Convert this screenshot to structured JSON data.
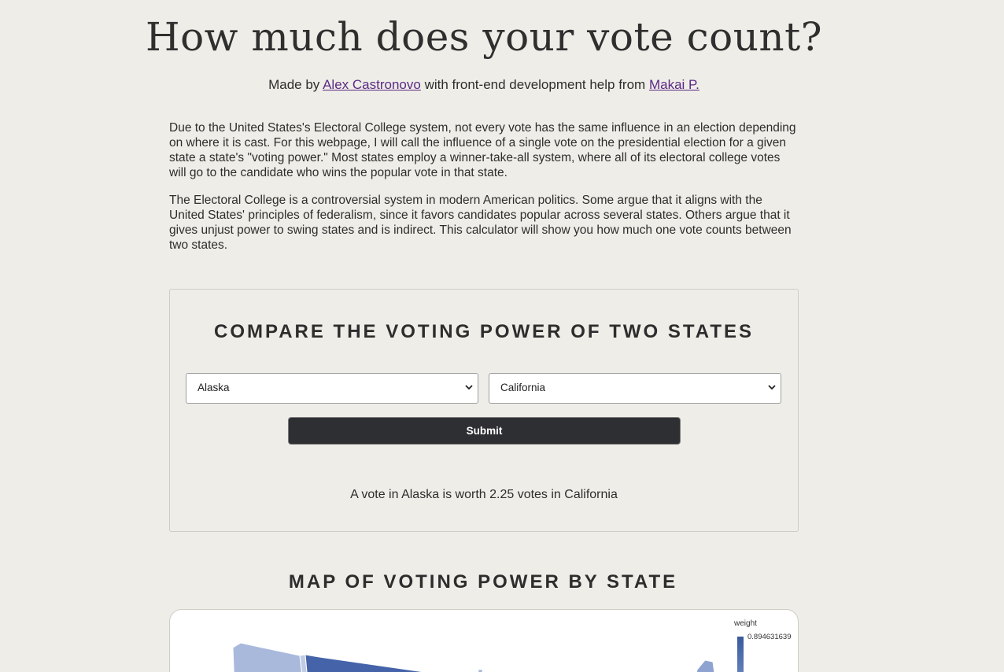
{
  "page": {
    "title": "How much does your vote count?",
    "byline": {
      "prefix": "Made by",
      "author_link": "Alex Castronovo",
      "middle": "with front-end development help from",
      "helper_link": "Makai P."
    },
    "intro_paragraphs": [
      "Due to the United States's Electoral College system, not every vote has the same influence in an election depending on where it is cast. For this webpage, I will call the influence of a single vote on the presidential election for a given state a state's \"voting power.\" Most states employ a winner-take-all system, where all of its electoral college votes will go to the candidate who wins the popular vote in that state.",
      "The Electoral College is a controversial system in modern American politics. Some argue that it aligns with the United States' principles of federalism, since it favors candidates popular across several states. Others argue that it gives unjust power to swing states and is indirect. This calculator will show you how much one vote counts between two states."
    ]
  },
  "compare": {
    "heading": "COMPARE THE VOTING POWER OF TWO STATES",
    "state_a": "Alaska",
    "state_b": "California",
    "submit_label": "Submit",
    "result": "A vote in Alaska is worth 2.25 votes in California"
  },
  "map": {
    "heading": "MAP OF VOTING POWER BY STATE",
    "legend_title": "weight",
    "legend_max": "0.894631639",
    "colors": {
      "light": "#a9b9dc",
      "dark": "#4463a8"
    }
  },
  "colors": {
    "background": "#eeede7",
    "link": "#5b2a86",
    "button": "#2e2f33"
  }
}
